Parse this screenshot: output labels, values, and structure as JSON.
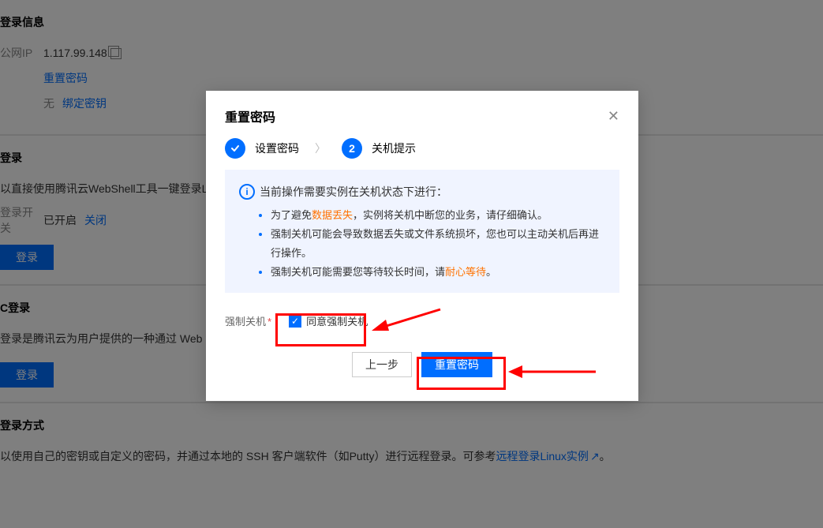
{
  "bg": {
    "sect1": {
      "title": "登录信息",
      "ip_label": "公网IP",
      "ip_value": "1.117.99.148",
      "reset_pw": "重置密码",
      "none": "无",
      "bind_key": "绑定密钥"
    },
    "sect2": {
      "title": "登录",
      "desc": "以直接使用腾讯云WebShell工具一键登录Linux实",
      "switch_label": "登录开关",
      "switch_status": "已开启",
      "switch_action": "关闭",
      "btn": "登录"
    },
    "sect3": {
      "title": "C登录",
      "desc": "登录是腾讯云为用户提供的一种通过 Web 浏览器",
      "btn": "登录"
    },
    "sect4": {
      "title": "登录方式",
      "desc_before": "以使用自己的密钥或自定义的密码，并通过本地的 SSH 客户端软件（如Putty）进行远程登录。可参考",
      "link": "远程登录Linux实例",
      "desc_after": "。"
    }
  },
  "modal": {
    "title": "重置密码",
    "step1": "设置密码",
    "step2_num": "2",
    "step2": "关机提示",
    "alert_head": "当前操作需要实例在关机状态下进行：",
    "bullets": [
      {
        "pre": "为了避免",
        "warn": "数据丢失",
        "post": "，实例将关机中断您的业务，请仔细确认。"
      },
      {
        "pre": "强制关机可能会导致数据丢失或文件系统损坏，您也可以主动关机后再进行操作。",
        "warn": "",
        "post": ""
      },
      {
        "pre": "强制关机可能需要您等待较长时间，请",
        "warn": "耐心等待",
        "post": "。"
      }
    ],
    "force_label": "强制关机",
    "chk_label": "同意强制关机",
    "prev": "上一步",
    "submit": "重置密码"
  }
}
